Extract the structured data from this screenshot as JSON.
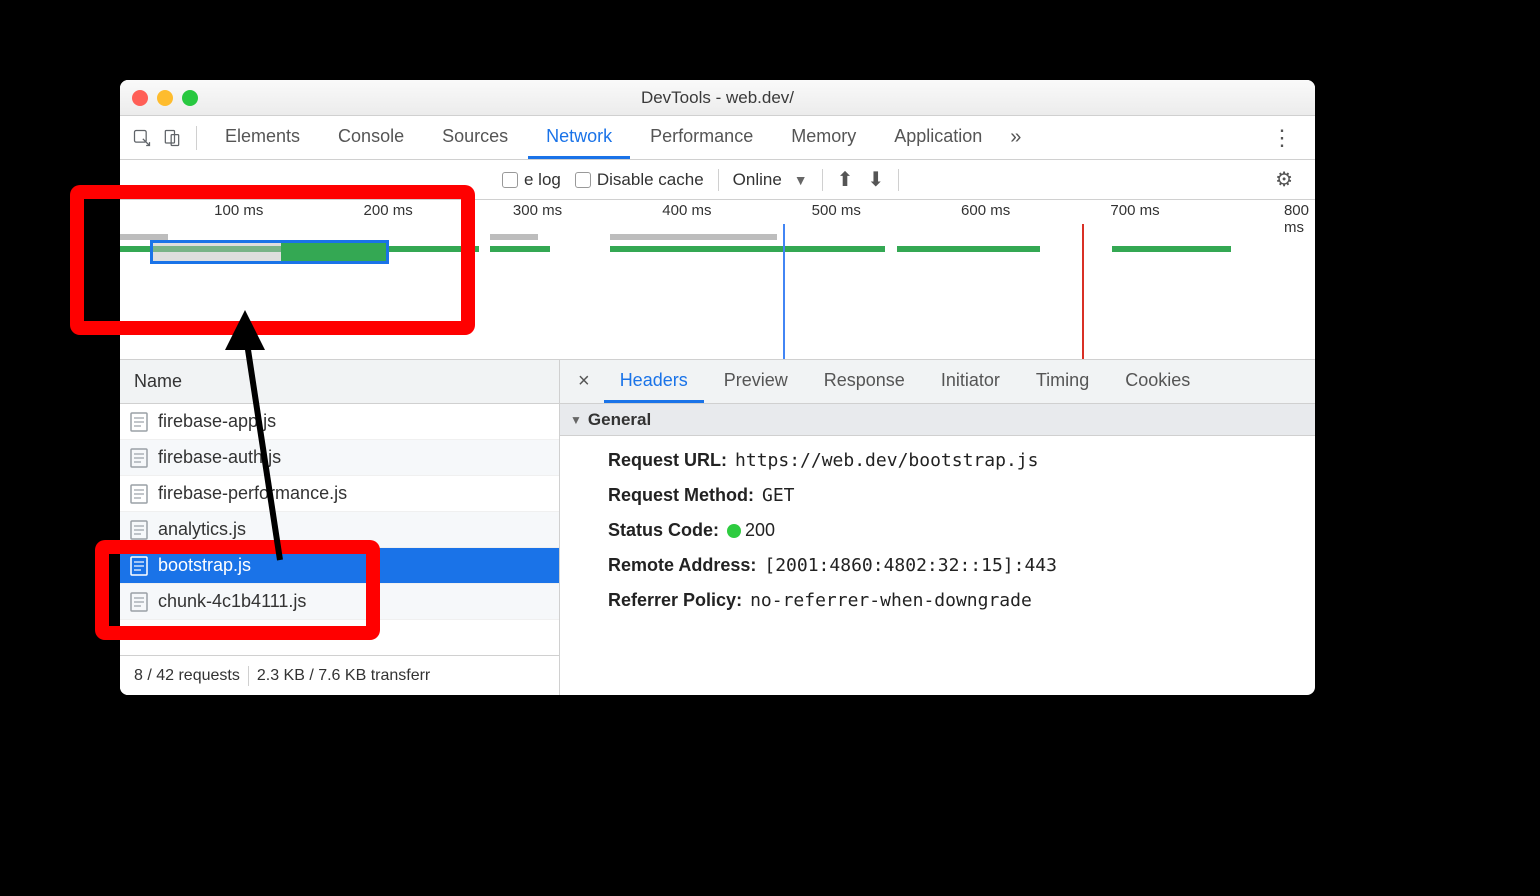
{
  "window": {
    "title": "DevTools - web.dev/"
  },
  "mainTabs": {
    "items": [
      "Elements",
      "Console",
      "Sources",
      "Network",
      "Performance",
      "Memory",
      "Application"
    ],
    "active": "Network"
  },
  "toolbar": {
    "preserve_log": "Preserve log",
    "disable_cache": "Disable cache",
    "throttling": "Online"
  },
  "ruler": {
    "ticks": [
      "100 ms",
      "200 ms",
      "300 ms",
      "400 ms",
      "500 ms",
      "600 ms",
      "700 ms",
      "800 ms"
    ]
  },
  "nameColumn": {
    "header": "Name"
  },
  "requests": [
    {
      "name": "firebase-app.js",
      "selected": false
    },
    {
      "name": "firebase-auth.js",
      "selected": false
    },
    {
      "name": "firebase-performance.js",
      "selected": false
    },
    {
      "name": "analytics.js",
      "selected": false
    },
    {
      "name": "bootstrap.js",
      "selected": true
    },
    {
      "name": "chunk-4c1b4111.js",
      "selected": false
    }
  ],
  "statusBar": {
    "requests": "8 / 42 requests",
    "transfer": "2.3 KB / 7.6 KB transferr"
  },
  "detailTabs": {
    "items": [
      "Headers",
      "Preview",
      "Response",
      "Initiator",
      "Timing",
      "Cookies"
    ],
    "active": "Headers"
  },
  "section": {
    "title": "General"
  },
  "headers": {
    "request_url_k": "Request URL:",
    "request_url_v": "https://web.dev/bootstrap.js",
    "method_k": "Request Method:",
    "method_v": "GET",
    "status_k": "Status Code:",
    "status_v": "200",
    "remote_k": "Remote Address:",
    "remote_v": "[2001:4860:4802:32::15]:443",
    "referrer_k": "Referrer Policy:",
    "referrer_v": "no-referrer-when-downgrade"
  }
}
